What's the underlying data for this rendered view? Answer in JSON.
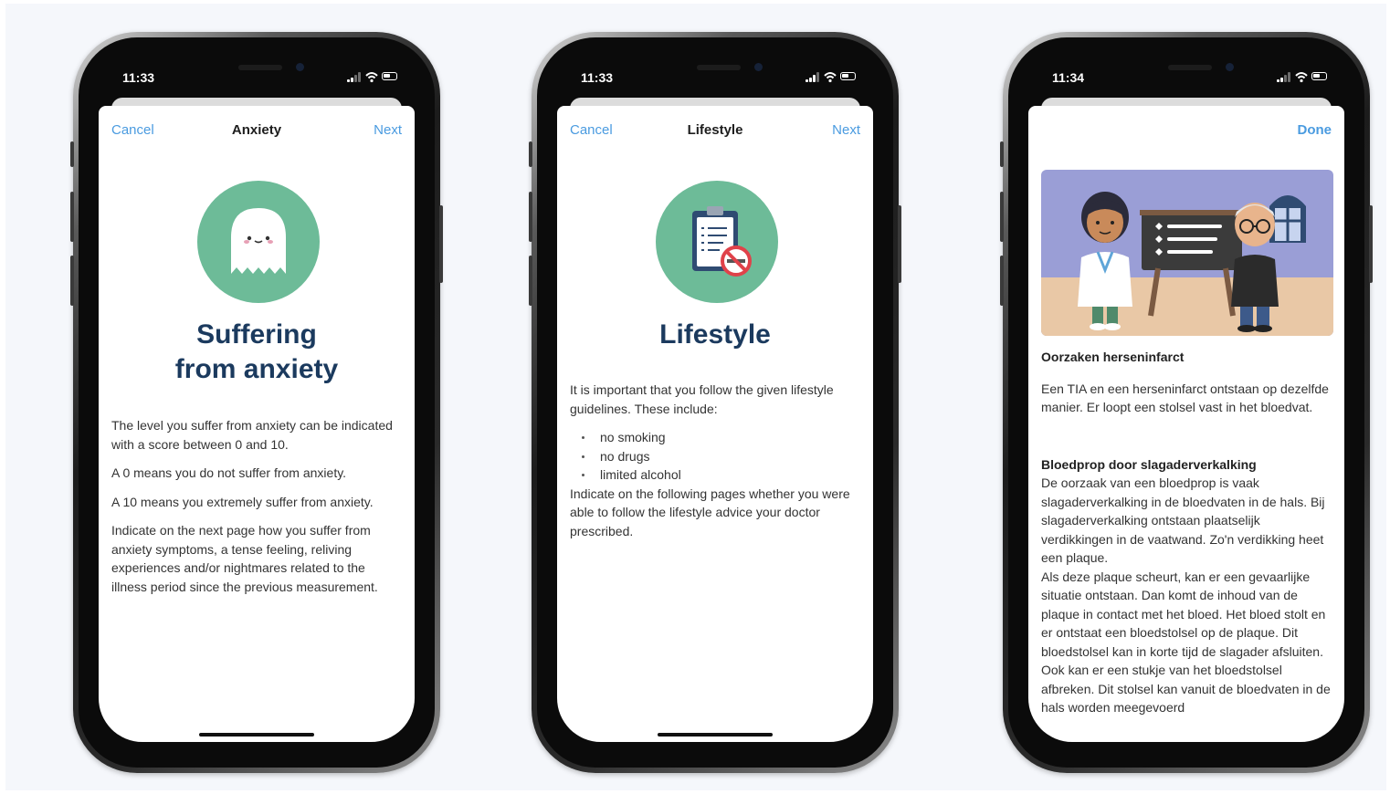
{
  "phones": [
    {
      "status_time": "11:33",
      "nav": {
        "cancel": "Cancel",
        "title": "Anxiety",
        "next": "Next"
      },
      "icon": "ghost-icon",
      "title_line1": "Suffering",
      "title_line2": "from anxiety",
      "paragraphs": [
        "The level you suffer from anxiety can be indicated with a score between 0 and 10.",
        "A 0 means you do not suffer from anxiety.",
        "A 10 means you extremely suffer from anxiety.",
        "Indicate on the next page how you suffer from anxiety symptoms, a tense feeling, reliving experiences and/or nightmares related to the illness period since the previous measurement."
      ]
    },
    {
      "status_time": "11:33",
      "nav": {
        "cancel": "Cancel",
        "title": "Lifestyle",
        "next": "Next"
      },
      "icon": "clipboard-no-smoking-icon",
      "title": "Lifestyle",
      "intro": "It is important that you follow the given lifestyle guidelines. These include:",
      "bullets": [
        "no smoking",
        "no drugs",
        "limited alcohol"
      ],
      "outro": "Indicate on the following pages whether you were able to follow the lifestyle advice your doctor prescribed."
    },
    {
      "status_time": "11:34",
      "nav": {
        "done": "Done"
      },
      "illustration": "doctor-and-patient-illustration",
      "heading1": "Oorzaken herseninfarct",
      "para1": "Een TIA en een herseninfarct ontstaan op dezelfde manier. Er loopt een stolsel vast in het bloedvat.",
      "heading2": "Bloedprop door slagaderverkalking",
      "para2": "De oorzaak van een bloedprop is vaak slagaderverkalking in de bloedvaten in de hals. Bij slagaderverkalking ontstaan plaatselijk verdikkingen in de vaatwand. Zo'n verdikking heet een plaque.",
      "para3": "Als deze plaque scheurt, kan er een gevaarlijke situatie ontstaan. Dan komt de inhoud van de plaque in contact met het bloed. Het bloed stolt en er ontstaat een bloedstolsel op de plaque. Dit bloedstolsel kan in korte tijd de slagader afsluiten. Ook kan er een stukje van het bloedstolsel afbreken. Dit stolsel kan vanuit de bloedvaten in de hals worden meegevoerd"
    }
  ],
  "colors": {
    "accent_blue": "#4a9be0",
    "title_navy": "#1b3a5e",
    "icon_green": "#6dbb98"
  }
}
